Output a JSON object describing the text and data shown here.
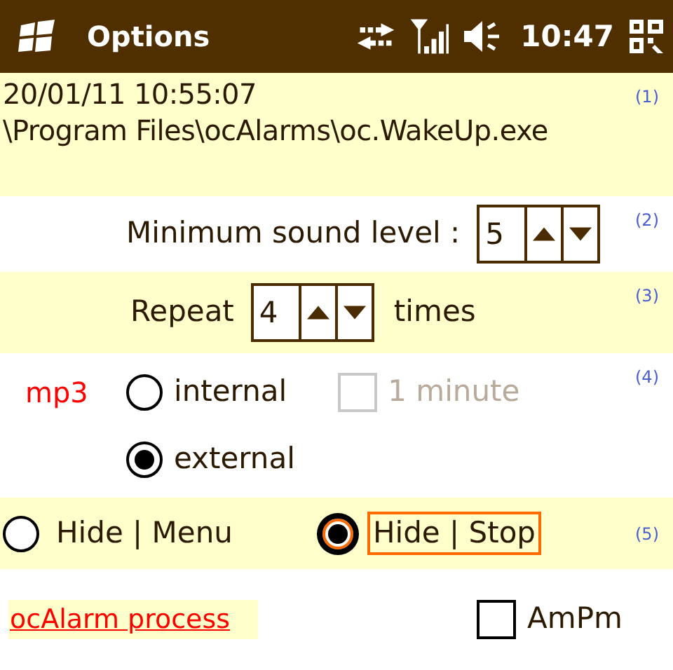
{
  "title_bar": {
    "title": "Options",
    "time": "10:47"
  },
  "alarm": {
    "datetime": "20/01/11 10:55:07",
    "path": "\\Program Files\\ocAlarms\\oc.WakeUp.exe",
    "note": "(1)"
  },
  "sound_level": {
    "label": "Minimum sound level :",
    "value": "5",
    "note": "(2)"
  },
  "repeat": {
    "label": "Repeat",
    "value": "4",
    "suffix": "times",
    "note": "(3)"
  },
  "mp3": {
    "label": "mp3",
    "note": "(4)",
    "options": [
      {
        "label": "internal",
        "selected": false
      },
      {
        "label": "external",
        "selected": true
      }
    ],
    "minute": {
      "label": "1 minute",
      "checked": false,
      "disabled": true
    }
  },
  "hide": {
    "note": "(5)",
    "options": [
      {
        "label": "Hide | Menu",
        "selected": false,
        "focused": false
      },
      {
        "label": "Hide | Stop",
        "selected": true,
        "focused": true
      }
    ]
  },
  "process_link": "ocAlarm process",
  "ampm": {
    "label": "AmPm",
    "checked": false
  }
}
